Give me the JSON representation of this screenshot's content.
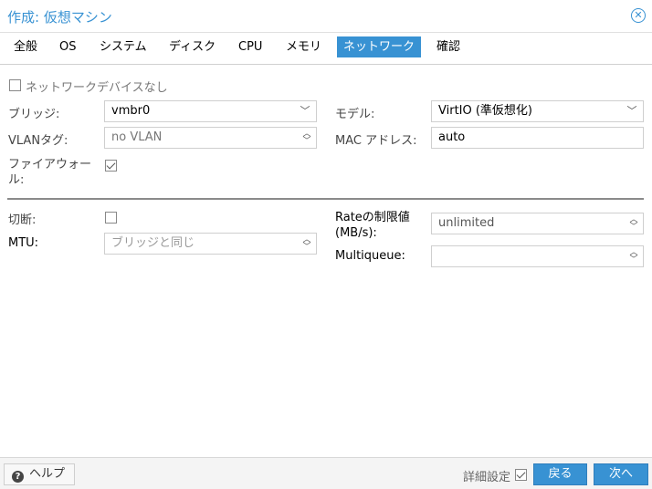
{
  "window": {
    "title": "作成: 仮想マシン",
    "close_icon": "close-icon"
  },
  "tabs": [
    {
      "label": "全般"
    },
    {
      "label": "OS"
    },
    {
      "label": "システム"
    },
    {
      "label": "ディスク"
    },
    {
      "label": "CPU"
    },
    {
      "label": "メモリ"
    },
    {
      "label": "ネットワーク",
      "active": true
    },
    {
      "label": "確認"
    }
  ],
  "network": {
    "no_device_label": "ネットワークデバイスなし",
    "bridge": {
      "label": "ブリッジ:",
      "value": "vmbr0"
    },
    "vlan": {
      "label": "VLANタグ:",
      "value": "no VLAN"
    },
    "firewall": {
      "label": "ファイアウォール:",
      "checked": true
    },
    "model": {
      "label": "モデル:",
      "value": "VirtIO (準仮想化)"
    },
    "mac": {
      "label": "MAC アドレス:",
      "value": "auto"
    }
  },
  "advanced": {
    "disconnect": {
      "label": "切断:",
      "checked": false
    },
    "mtu": {
      "label": "MTU:",
      "placeholder": "ブリッジと同じ"
    },
    "rate_limit": {
      "label": "Rateの制限値 (MB/s):",
      "value": "unlimited"
    },
    "multiqueue": {
      "label": "Multiqueue:",
      "value": ""
    }
  },
  "footer": {
    "help_label": "ヘルプ",
    "advanced_label": "詳細設定",
    "advanced_checked": true,
    "back_label": "戻る",
    "next_label": "次へ"
  },
  "colors": {
    "accent": "#3892d3"
  }
}
